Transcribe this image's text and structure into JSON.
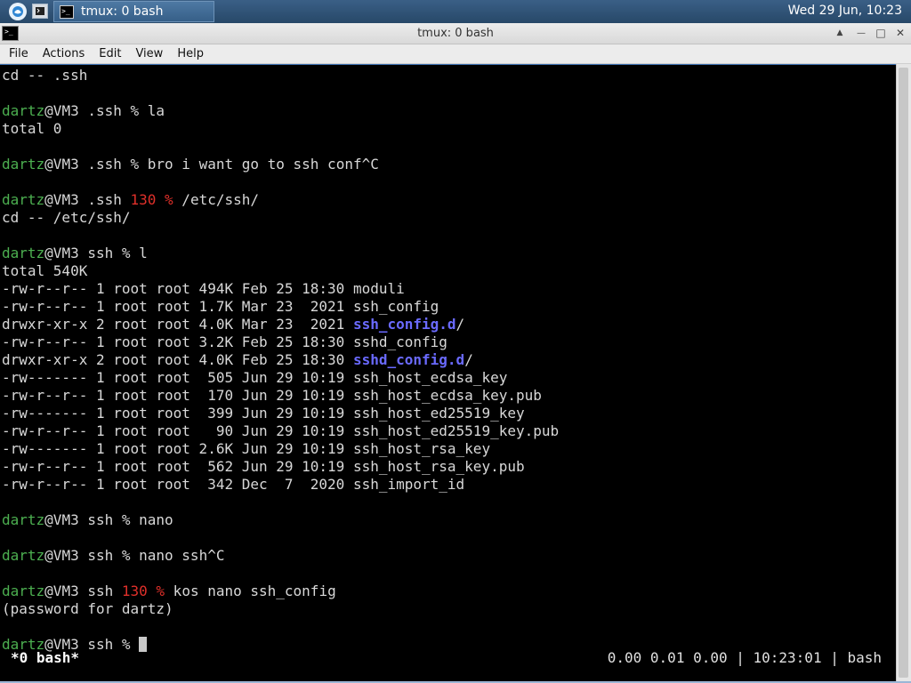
{
  "panel": {
    "launcher_icon": "xfce-launcher-icon",
    "desktop_icon": "terminal-icon",
    "task_label": "tmux: 0 bash",
    "clock": "Wed 29 Jun, 10:23"
  },
  "window": {
    "title": "tmux: 0 bash",
    "icons": {
      "up": "▲",
      "min": "—",
      "max": "□",
      "close": "✕"
    }
  },
  "menu": {
    "file": "File",
    "actions": "Actions",
    "edit": "Edit",
    "view": "View",
    "help": "Help"
  },
  "terminal": {
    "lines": [
      [
        {
          "t": "cd -- .ssh"
        }
      ],
      [],
      [
        {
          "t": "dartz",
          "c": "green"
        },
        {
          "t": "@VM3 .ssh % la"
        }
      ],
      [
        {
          "t": "total 0"
        }
      ],
      [],
      [
        {
          "t": "dartz",
          "c": "green"
        },
        {
          "t": "@VM3 .ssh % bro i want go to ssh conf^C"
        }
      ],
      [],
      [
        {
          "t": "dartz",
          "c": "green"
        },
        {
          "t": "@VM3 .ssh "
        },
        {
          "t": "130 %",
          "c": "red"
        },
        {
          "t": " /etc/ssh/"
        }
      ],
      [
        {
          "t": "cd -- /etc/ssh/"
        }
      ],
      [],
      [
        {
          "t": "dartz",
          "c": "green"
        },
        {
          "t": "@VM3 ssh % l"
        }
      ],
      [
        {
          "t": "total 540K"
        }
      ],
      [
        {
          "t": "-rw-r--r-- 1 root root 494K Feb 25 18:30 moduli"
        }
      ],
      [
        {
          "t": "-rw-r--r-- 1 root root 1.7K Mar 23  2021 ssh_config"
        }
      ],
      [
        {
          "t": "drwxr-xr-x 2 root root 4.0K Mar 23  2021 "
        },
        {
          "t": "ssh_config.d",
          "c": "blue"
        },
        {
          "t": "/"
        }
      ],
      [
        {
          "t": "-rw-r--r-- 1 root root 3.2K Feb 25 18:30 sshd_config"
        }
      ],
      [
        {
          "t": "drwxr-xr-x 2 root root 4.0K Feb 25 18:30 "
        },
        {
          "t": "sshd_config.d",
          "c": "blue"
        },
        {
          "t": "/"
        }
      ],
      [
        {
          "t": "-rw------- 1 root root  505 Jun 29 10:19 ssh_host_ecdsa_key"
        }
      ],
      [
        {
          "t": "-rw-r--r-- 1 root root  170 Jun 29 10:19 ssh_host_ecdsa_key.pub"
        }
      ],
      [
        {
          "t": "-rw------- 1 root root  399 Jun 29 10:19 ssh_host_ed25519_key"
        }
      ],
      [
        {
          "t": "-rw-r--r-- 1 root root   90 Jun 29 10:19 ssh_host_ed25519_key.pub"
        }
      ],
      [
        {
          "t": "-rw------- 1 root root 2.6K Jun 29 10:19 ssh_host_rsa_key"
        }
      ],
      [
        {
          "t": "-rw-r--r-- 1 root root  562 Jun 29 10:19 ssh_host_rsa_key.pub"
        }
      ],
      [
        {
          "t": "-rw-r--r-- 1 root root  342 Dec  7  2020 ssh_import_id"
        }
      ],
      [],
      [
        {
          "t": "dartz",
          "c": "green"
        },
        {
          "t": "@VM3 ssh % nano"
        }
      ],
      [],
      [
        {
          "t": "dartz",
          "c": "green"
        },
        {
          "t": "@VM3 ssh % nano ssh^C"
        }
      ],
      [],
      [
        {
          "t": "dartz",
          "c": "green"
        },
        {
          "t": "@VM3 ssh "
        },
        {
          "t": "130 %",
          "c": "red"
        },
        {
          "t": " kos nano ssh_config"
        }
      ],
      [
        {
          "t": "(password for dartz)"
        }
      ],
      [],
      [
        {
          "t": "dartz",
          "c": "green"
        },
        {
          "t": "@VM3 ssh % "
        },
        {
          "cursor": true
        }
      ]
    ]
  },
  "tmux": {
    "left": "*0 bash*",
    "right": "0.00 0.01 0.00 | 10:23:01 | bash"
  },
  "colors": {
    "green": "#4caf50",
    "red": "#e0302a",
    "blue": "#6a6aff",
    "text": "#d8d8d8",
    "panel": "#274868"
  }
}
